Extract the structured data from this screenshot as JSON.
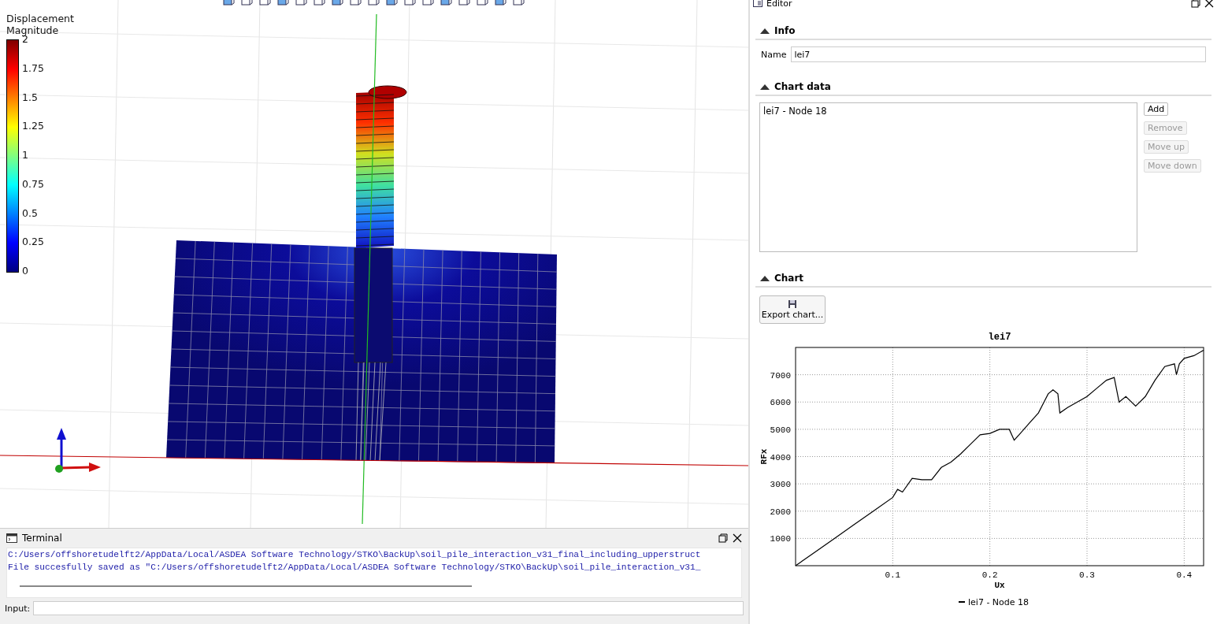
{
  "viewport": {
    "legend": {
      "title": "Displacement Magnitude",
      "labels": [
        "2",
        "1.75",
        "1.5",
        "1.25",
        "1",
        "0.75",
        "0.5",
        "0.25",
        "0"
      ]
    }
  },
  "terminal": {
    "title": "Terminal",
    "lines": [
      "C:/Users/offshoretudelft2/AppData/Local/ASDEA Software Technology/STKO\\BackUp\\soil_pile_interaction_v31_final_including_upperstruct",
      "File succesfully saved as \"C:/Users/offshoretudelft2/AppData/Local/ASDEA Software Technology/STKO\\BackUp\\soil_pile_interaction_v31_"
    ],
    "input_label": "Input:"
  },
  "editor": {
    "title": "Editor",
    "info": {
      "title": "Info",
      "expanded": true,
      "name_label": "Name",
      "name_value": "lei7"
    },
    "chart_data_section": {
      "title": "Chart data",
      "expanded": true,
      "items": [
        "lei7 - Node 18"
      ],
      "buttons": [
        {
          "label": "Add",
          "disabled": false
        },
        {
          "label": "Remove",
          "disabled": true
        },
        {
          "label": "Move up",
          "disabled": true
        },
        {
          "label": "Move down",
          "disabled": true
        }
      ]
    },
    "chart_section": {
      "title": "Chart",
      "expanded": true,
      "export_button": "Export chart...",
      "chart_data": {
        "type": "line",
        "grid": true,
        "title": "lei7",
        "xlabel": "Ux",
        "ylabel": "RFx",
        "xlim": [
          0,
          0.42
        ],
        "ylim": [
          0,
          8000
        ],
        "xticks": [
          0.1,
          0.2,
          0.3,
          0.4
        ],
        "yticks": [
          1000,
          2000,
          3000,
          4000,
          5000,
          6000,
          7000
        ],
        "x": [
          0,
          0.02,
          0.04,
          0.06,
          0.08,
          0.1,
          0.105,
          0.11,
          0.12,
          0.13,
          0.14,
          0.15,
          0.16,
          0.17,
          0.18,
          0.19,
          0.2,
          0.21,
          0.22,
          0.225,
          0.23,
          0.24,
          0.25,
          0.26,
          0.265,
          0.27,
          0.272,
          0.28,
          0.29,
          0.3,
          0.31,
          0.32,
          0.328,
          0.333,
          0.34,
          0.35,
          0.36,
          0.37,
          0.38,
          0.39,
          0.392,
          0.395,
          0.4,
          0.41,
          0.42
        ],
        "series": [
          {
            "name": "lei7 - Node 18",
            "color": "#000000",
            "values": [
              0,
              500,
              1000,
              1500,
              2000,
              2500,
              2800,
              2700,
              3200,
              3150,
              3150,
              3600,
              3800,
              4100,
              4450,
              4800,
              4850,
              5000,
              5000,
              4600,
              4800,
              5200,
              5600,
              6300,
              6450,
              6300,
              5600,
              5800,
              6000,
              6200,
              6500,
              6800,
              6900,
              6000,
              6200,
              5850,
              6200,
              6800,
              7300,
              7400,
              7000,
              7400,
              7600,
              7700,
              7900
            ]
          }
        ]
      }
    }
  }
}
